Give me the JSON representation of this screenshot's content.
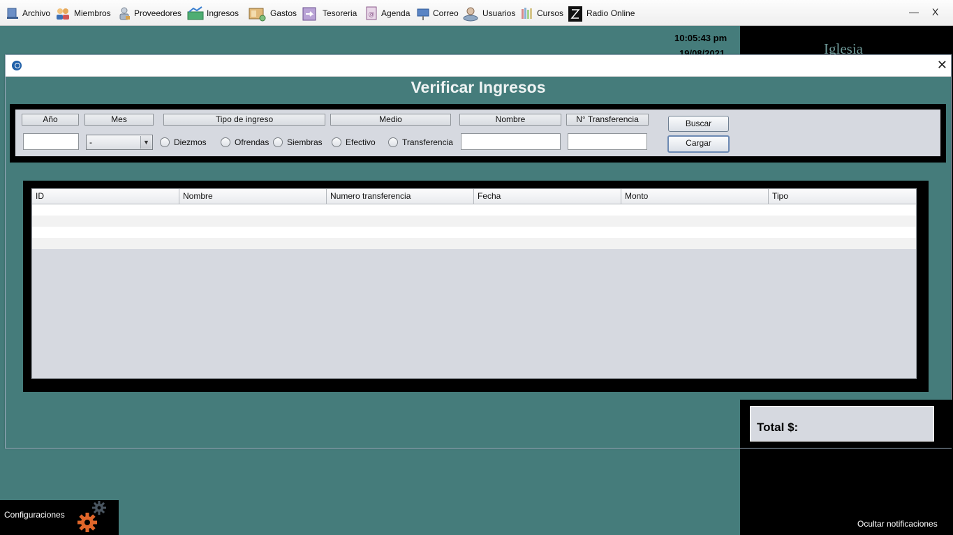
{
  "menu": {
    "items": [
      {
        "label": "Archivo",
        "icon": "archive-icon"
      },
      {
        "label": "Miembros",
        "icon": "members-icon"
      },
      {
        "label": "Proveedores",
        "icon": "providers-icon"
      },
      {
        "label": "Ingresos",
        "icon": "income-icon"
      },
      {
        "label": "Gastos",
        "icon": "expenses-icon"
      },
      {
        "label": "Tesoreria",
        "icon": "treasury-icon"
      },
      {
        "label": "Agenda",
        "icon": "agenda-icon"
      },
      {
        "label": "Correo",
        "icon": "mail-icon"
      },
      {
        "label": "Usuarios",
        "icon": "users-icon"
      },
      {
        "label": "Cursos",
        "icon": "courses-icon"
      },
      {
        "label": "Radio Online",
        "icon": "radio-icon"
      }
    ],
    "minimize": "—",
    "close": "X"
  },
  "clock": {
    "time": "10:05:43 pm",
    "date": "19/08/2021"
  },
  "notifications": {
    "title": "Iglesia",
    "hide_label": "Ocultar notificaciones"
  },
  "frame": {
    "close": "✕",
    "heading": "Verificar Ingresos",
    "filters": {
      "year_label": "Año",
      "year_value": "",
      "month_label": "Mes",
      "month_value": "-",
      "type_label": "Tipo de ingreso",
      "type_options": [
        "Diezmos",
        "Ofrendas",
        "Siembras"
      ],
      "medium_label": "Medio",
      "medium_options": [
        "Efectivo",
        "Transferencia"
      ],
      "name_label": "Nombre",
      "name_value": "",
      "transfer_label": "N° Transferencia",
      "transfer_value": "",
      "search_button": "Buscar",
      "load_button": "Cargar"
    },
    "table": {
      "columns": [
        "ID",
        "Nombre",
        "Numero transferencia",
        "Fecha",
        "Monto",
        "Tipo"
      ],
      "rows": []
    },
    "total_label": "Total $:"
  },
  "config": {
    "label": "Configuraciones"
  },
  "colors": {
    "desktop": "#457c7b",
    "panel": "#000000",
    "form_bg": "#d6d9e0",
    "gear_orange": "#e0662a",
    "gear_gray": "#4a5560"
  }
}
